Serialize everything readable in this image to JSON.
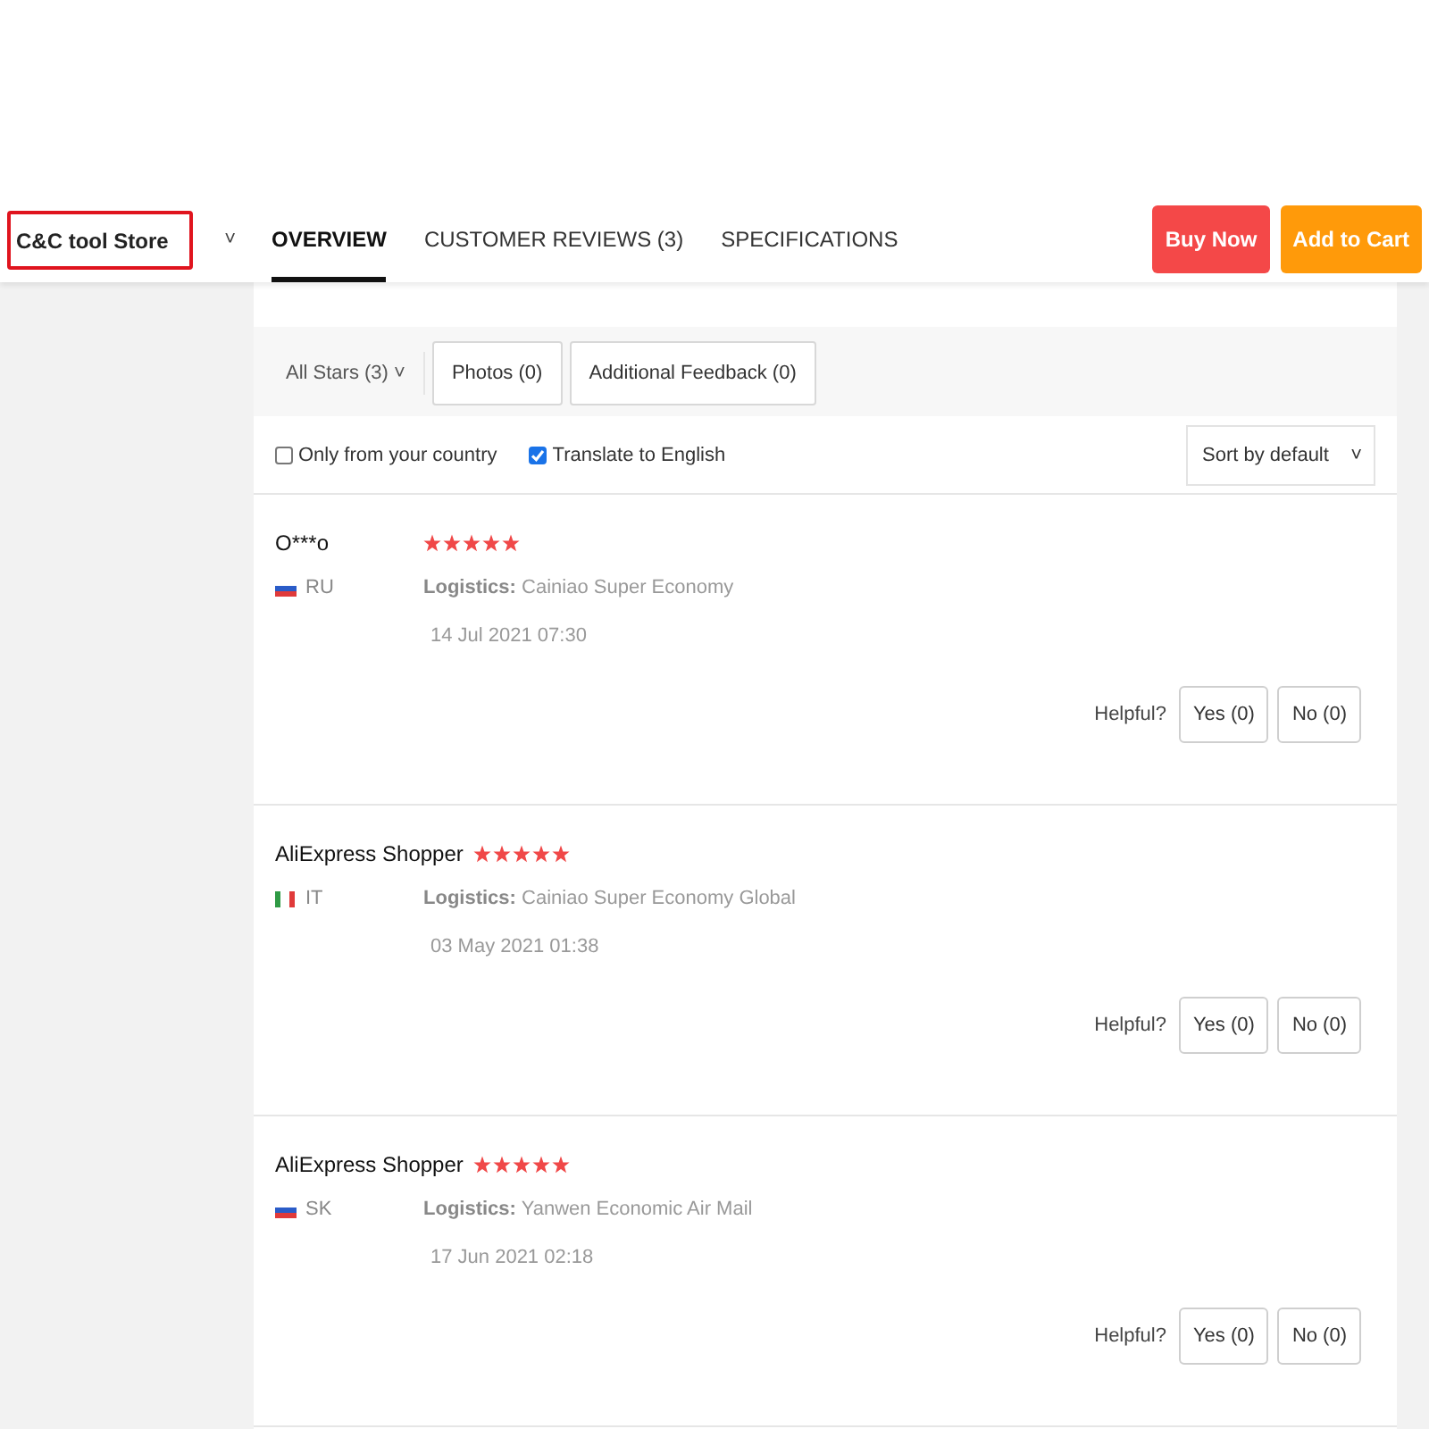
{
  "store": {
    "name": "C&C tool Store",
    "caret": "˅"
  },
  "tabs": [
    {
      "label": "OVERVIEW",
      "selected": true
    },
    {
      "label": "CUSTOMER REVIEWS (3)",
      "selected": false
    },
    {
      "label": "SPECIFICATIONS",
      "selected": false
    }
  ],
  "actions": [
    {
      "label": "Buy Now",
      "color": "#f44848"
    },
    {
      "label": "Add to Cart",
      "color": "#ff9a0a"
    }
  ],
  "filters": {
    "stars": {
      "label": "All Stars (3)",
      "caret": "˅"
    },
    "buttons": [
      "Photos (0)",
      "Additional Feedback (0)"
    ]
  },
  "options": [
    {
      "label": "Only from your country",
      "checked": false
    },
    {
      "label": "Translate to English",
      "checked": true
    }
  ],
  "sort": {
    "value": "Sort by default",
    "caret": "˅"
  },
  "reviews": [
    {
      "user": "O***o",
      "stars": 5,
      "country": "RU",
      "flag": {
        "kind": "horizontal"
      },
      "logistics_label": "Logistics:",
      "logistics": "Cainiao Super Economy",
      "date": "14 Jul 2021 07:30",
      "helpful": "Helpful?",
      "yes": "Yes (0)",
      "no": "No (0)"
    },
    {
      "user": "AliExpress Shopper",
      "stars": 5,
      "country": "IT",
      "flag": {
        "kind": "vertical"
      },
      "logistics_label": "Logistics:",
      "logistics": "Cainiao Super Economy Global",
      "date": "03 May 2021 01:38",
      "helpful": "Helpful?",
      "yes": "Yes (0)",
      "no": "No (0)"
    },
    {
      "user": "AliExpress Shopper",
      "stars": 5,
      "country": "SK",
      "flag": {
        "kind": "horizontal"
      },
      "logistics_label": "Logistics:",
      "logistics": "Yanwen Economic Air Mail",
      "date": "17 Jun 2021 02:18",
      "helpful": "Helpful?",
      "yes": "Yes (0)",
      "no": "No (0)"
    }
  ]
}
